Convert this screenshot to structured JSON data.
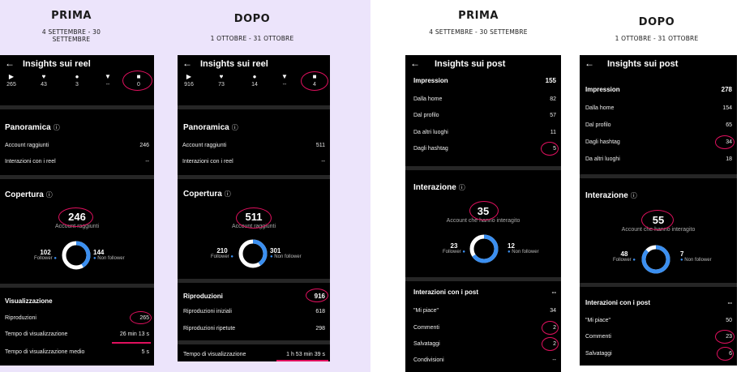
{
  "captions": {
    "before": "PRIMA",
    "after": "DOPO",
    "reel_before_dates": "4 SETTEMBRE - 30 SETTEMBRE",
    "reel_after_dates": "1 OTTOBRE - 31 OTTOBRE",
    "post_before_dates": "4 SETTEMBRE - 30 SETTEMBRE",
    "post_after_dates": "1 OTTOBRE - 31 OTTOBRE"
  },
  "colors": {
    "accent": "#e0105e",
    "donut": "#3b8ff0",
    "left_bg": "#ece4fb"
  },
  "icons": [
    "play-icon",
    "heart-icon",
    "comment-icon",
    "share-icon",
    "bookmark-icon",
    "back-arrow-icon",
    "info-icon"
  ],
  "reel_before": {
    "title": "Insights sui reel",
    "stats": [
      "265",
      "43",
      "3",
      "--",
      "0"
    ],
    "overview_title": "Panoramica",
    "accounts_reached_label": "Account raggiunti",
    "accounts_reached": "246",
    "reel_interactions_label": "Interazioni con i reel",
    "reel_interactions": "--",
    "reach_title": "Copertura",
    "reach_total": "246",
    "reach_sub": "Account raggiunti",
    "followers": "102",
    "followers_label": "Follower",
    "non_followers": "144",
    "non_followers_label": "Non follower",
    "views_title": "Visualizzazione",
    "plays_label": "Riproduzioni",
    "plays": "265",
    "watch_time_label": "Tempo di visualizzazione",
    "watch_time": "26 min 13 s",
    "avg_watch_time_label": "Tempo di visualizzazione medio",
    "avg_watch_time": "5 s"
  },
  "reel_after": {
    "title": "Insights sui reel",
    "stats": [
      "916",
      "73",
      "14",
      "--",
      "4"
    ],
    "overview_title": "Panoramica",
    "accounts_reached_label": "Account raggiunti",
    "accounts_reached": "511",
    "reel_interactions_label": "Interazioni con i reel",
    "reel_interactions": "--",
    "reach_title": "Copertura",
    "reach_total": "511",
    "reach_sub": "Account raggiunti",
    "followers": "210",
    "followers_label": "Follower",
    "non_followers": "301",
    "non_followers_label": "Non follower",
    "plays_title": "Riproduzioni",
    "plays": "916",
    "initial_plays_label": "Riproduzioni iniziali",
    "initial_plays": "618",
    "replays_label": "Riproduzioni ripetute",
    "replays": "298",
    "watch_time_label": "Tempo di visualizzazione",
    "watch_time": "1 h 53 min 39 s"
  },
  "post_before": {
    "title": "Insights sui post",
    "impressions_label": "Impression",
    "impressions": "155",
    "from_home_label": "Dalla home",
    "from_home": "82",
    "from_profile_label": "Dal profilo",
    "from_profile": "57",
    "from_other_label": "Da altri luoghi",
    "from_other": "11",
    "from_hashtags_label": "Dagli hashtag",
    "from_hashtags": "5",
    "interactions_title": "Interazione",
    "interactions_total": "35",
    "interactions_sub": "Account che hanno interagito",
    "followers": "23",
    "followers_label": "Follower",
    "non_followers": "12",
    "non_followers_label": "Non follower",
    "post_interactions_label": "Interazioni con i post",
    "post_interactions": "--",
    "likes_label": "\"Mi piace\"",
    "likes": "34",
    "comments_label": "Commenti",
    "comments": "2",
    "saves_label": "Salvataggi",
    "saves": "2",
    "shares_label": "Condivisioni",
    "shares": "--"
  },
  "post_after": {
    "title": "Insights sui post",
    "impressions_label": "Impression",
    "impressions": "278",
    "from_home_label": "Dalla home",
    "from_home": "154",
    "from_profile_label": "Dal profilo",
    "from_profile": "65",
    "from_hashtags_label": "Dagli hashtag",
    "from_hashtags": "34",
    "from_other_label": "Da altri luoghi",
    "from_other": "18",
    "interactions_title": "Interazione",
    "interactions_total": "55",
    "interactions_sub": "Account che hanno interagito",
    "followers": "48",
    "followers_label": "Follower",
    "non_followers": "7",
    "non_followers_label": "Non follower",
    "post_interactions_label": "Interazioni con i post",
    "post_interactions": "--",
    "likes_label": "\"Mi piace\"",
    "likes": "50",
    "comments_label": "Commenti",
    "comments": "23",
    "saves_label": "Salvataggi",
    "saves": "6"
  }
}
